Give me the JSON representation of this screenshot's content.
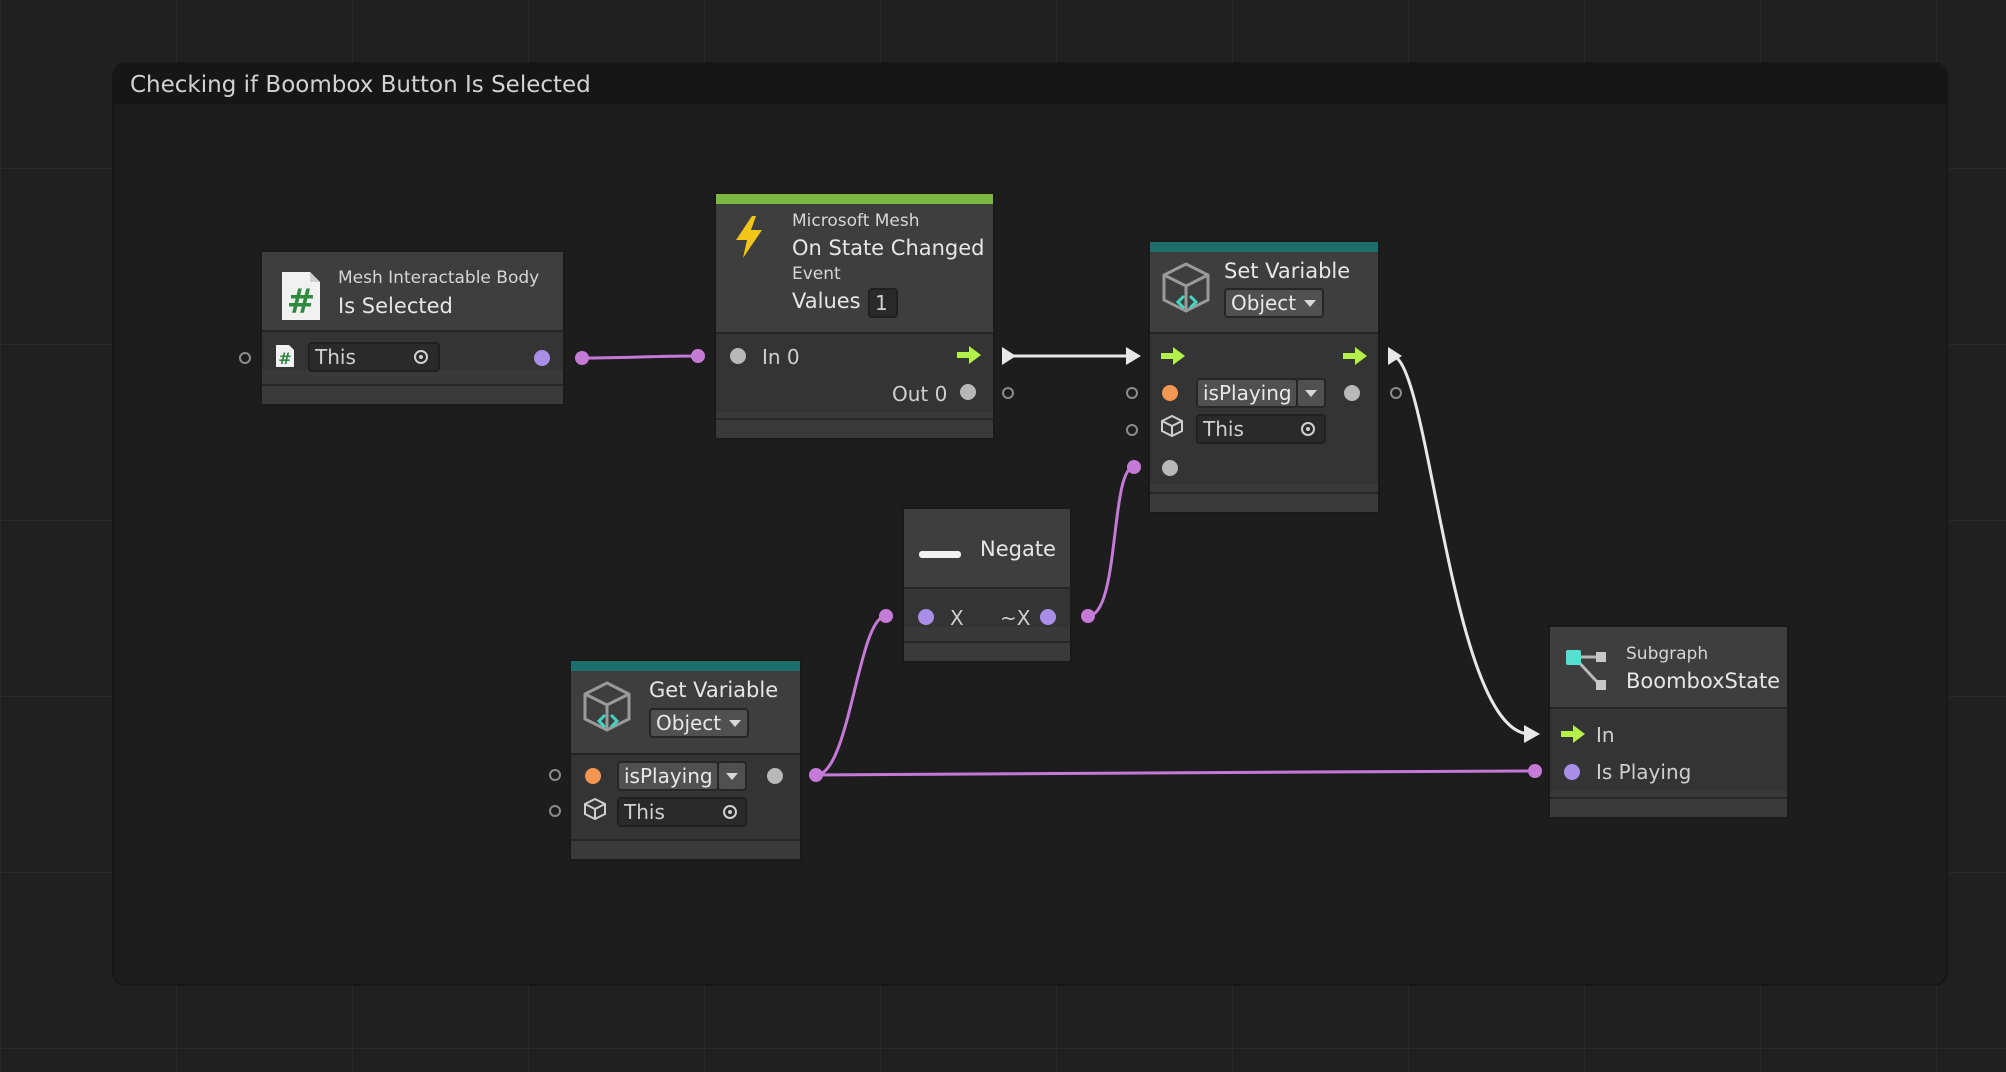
{
  "group": {
    "title": "Checking if Boombox Button Is Selected"
  },
  "nodes": {
    "is_selected": {
      "category": "Mesh Interactable Body",
      "title": "Is Selected",
      "target_value": "This"
    },
    "on_state_changed": {
      "category": "Microsoft Mesh",
      "title": "On State Changed",
      "subtitle": "Event",
      "values_label": "Values",
      "values_count": "1",
      "in_port": "In 0",
      "out_port": "Out 0"
    },
    "set_variable": {
      "title": "Set Variable",
      "kind": "Object",
      "variable": "isPlaying",
      "target_value": "This"
    },
    "negate": {
      "title": "Negate",
      "in_port": "X",
      "out_port": "~X"
    },
    "get_variable": {
      "title": "Get Variable",
      "kind": "Object",
      "variable": "isPlaying",
      "target_value": "This"
    },
    "subgraph": {
      "category": "Subgraph",
      "title": "BoomboxState",
      "in_port": "In",
      "value_port": "Is Playing"
    }
  },
  "colors": {
    "background": "#202020",
    "control_flow": "#b4f04a",
    "value_wire": "#c57ad6",
    "flow_wire": "#e8e8e8",
    "event_bar": "#7bb841",
    "variable_bar": "#1d6f6c",
    "bool_port": "#a98ee8",
    "object_port": "#f59652"
  },
  "icons": {
    "is_selected": "script-hash-icon",
    "on_state_changed": "lightning-icon",
    "set_variable": "cube-variable-icon",
    "negate": "minus-icon",
    "get_variable": "cube-variable-icon",
    "subgraph": "subgraph-icon"
  }
}
